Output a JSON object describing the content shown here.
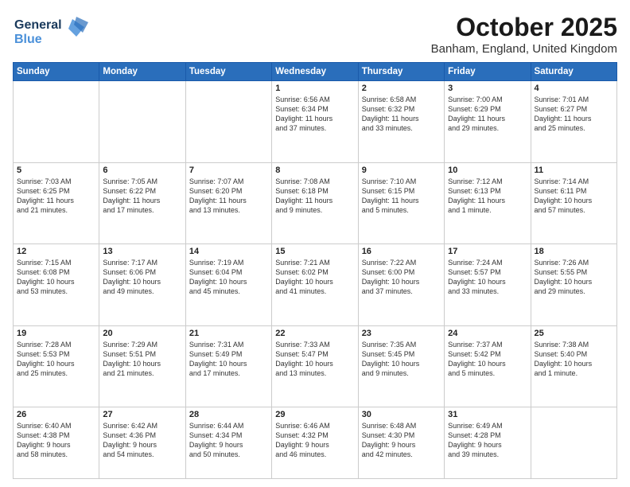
{
  "header": {
    "logo_line1": "General",
    "logo_line2": "Blue",
    "month_title": "October 2025",
    "location": "Banham, England, United Kingdom"
  },
  "weekdays": [
    "Sunday",
    "Monday",
    "Tuesday",
    "Wednesday",
    "Thursday",
    "Friday",
    "Saturday"
  ],
  "weeks": [
    [
      {
        "day": "",
        "info": ""
      },
      {
        "day": "",
        "info": ""
      },
      {
        "day": "",
        "info": ""
      },
      {
        "day": "1",
        "info": "Sunrise: 6:56 AM\nSunset: 6:34 PM\nDaylight: 11 hours\nand 37 minutes."
      },
      {
        "day": "2",
        "info": "Sunrise: 6:58 AM\nSunset: 6:32 PM\nDaylight: 11 hours\nand 33 minutes."
      },
      {
        "day": "3",
        "info": "Sunrise: 7:00 AM\nSunset: 6:29 PM\nDaylight: 11 hours\nand 29 minutes."
      },
      {
        "day": "4",
        "info": "Sunrise: 7:01 AM\nSunset: 6:27 PM\nDaylight: 11 hours\nand 25 minutes."
      }
    ],
    [
      {
        "day": "5",
        "info": "Sunrise: 7:03 AM\nSunset: 6:25 PM\nDaylight: 11 hours\nand 21 minutes."
      },
      {
        "day": "6",
        "info": "Sunrise: 7:05 AM\nSunset: 6:22 PM\nDaylight: 11 hours\nand 17 minutes."
      },
      {
        "day": "7",
        "info": "Sunrise: 7:07 AM\nSunset: 6:20 PM\nDaylight: 11 hours\nand 13 minutes."
      },
      {
        "day": "8",
        "info": "Sunrise: 7:08 AM\nSunset: 6:18 PM\nDaylight: 11 hours\nand 9 minutes."
      },
      {
        "day": "9",
        "info": "Sunrise: 7:10 AM\nSunset: 6:15 PM\nDaylight: 11 hours\nand 5 minutes."
      },
      {
        "day": "10",
        "info": "Sunrise: 7:12 AM\nSunset: 6:13 PM\nDaylight: 11 hours\nand 1 minute."
      },
      {
        "day": "11",
        "info": "Sunrise: 7:14 AM\nSunset: 6:11 PM\nDaylight: 10 hours\nand 57 minutes."
      }
    ],
    [
      {
        "day": "12",
        "info": "Sunrise: 7:15 AM\nSunset: 6:08 PM\nDaylight: 10 hours\nand 53 minutes."
      },
      {
        "day": "13",
        "info": "Sunrise: 7:17 AM\nSunset: 6:06 PM\nDaylight: 10 hours\nand 49 minutes."
      },
      {
        "day": "14",
        "info": "Sunrise: 7:19 AM\nSunset: 6:04 PM\nDaylight: 10 hours\nand 45 minutes."
      },
      {
        "day": "15",
        "info": "Sunrise: 7:21 AM\nSunset: 6:02 PM\nDaylight: 10 hours\nand 41 minutes."
      },
      {
        "day": "16",
        "info": "Sunrise: 7:22 AM\nSunset: 6:00 PM\nDaylight: 10 hours\nand 37 minutes."
      },
      {
        "day": "17",
        "info": "Sunrise: 7:24 AM\nSunset: 5:57 PM\nDaylight: 10 hours\nand 33 minutes."
      },
      {
        "day": "18",
        "info": "Sunrise: 7:26 AM\nSunset: 5:55 PM\nDaylight: 10 hours\nand 29 minutes."
      }
    ],
    [
      {
        "day": "19",
        "info": "Sunrise: 7:28 AM\nSunset: 5:53 PM\nDaylight: 10 hours\nand 25 minutes."
      },
      {
        "day": "20",
        "info": "Sunrise: 7:29 AM\nSunset: 5:51 PM\nDaylight: 10 hours\nand 21 minutes."
      },
      {
        "day": "21",
        "info": "Sunrise: 7:31 AM\nSunset: 5:49 PM\nDaylight: 10 hours\nand 17 minutes."
      },
      {
        "day": "22",
        "info": "Sunrise: 7:33 AM\nSunset: 5:47 PM\nDaylight: 10 hours\nand 13 minutes."
      },
      {
        "day": "23",
        "info": "Sunrise: 7:35 AM\nSunset: 5:45 PM\nDaylight: 10 hours\nand 9 minutes."
      },
      {
        "day": "24",
        "info": "Sunrise: 7:37 AM\nSunset: 5:42 PM\nDaylight: 10 hours\nand 5 minutes."
      },
      {
        "day": "25",
        "info": "Sunrise: 7:38 AM\nSunset: 5:40 PM\nDaylight: 10 hours\nand 1 minute."
      }
    ],
    [
      {
        "day": "26",
        "info": "Sunrise: 6:40 AM\nSunset: 4:38 PM\nDaylight: 9 hours\nand 58 minutes."
      },
      {
        "day": "27",
        "info": "Sunrise: 6:42 AM\nSunset: 4:36 PM\nDaylight: 9 hours\nand 54 minutes."
      },
      {
        "day": "28",
        "info": "Sunrise: 6:44 AM\nSunset: 4:34 PM\nDaylight: 9 hours\nand 50 minutes."
      },
      {
        "day": "29",
        "info": "Sunrise: 6:46 AM\nSunset: 4:32 PM\nDaylight: 9 hours\nand 46 minutes."
      },
      {
        "day": "30",
        "info": "Sunrise: 6:48 AM\nSunset: 4:30 PM\nDaylight: 9 hours\nand 42 minutes."
      },
      {
        "day": "31",
        "info": "Sunrise: 6:49 AM\nSunset: 4:28 PM\nDaylight: 9 hours\nand 39 minutes."
      },
      {
        "day": "",
        "info": ""
      }
    ]
  ]
}
